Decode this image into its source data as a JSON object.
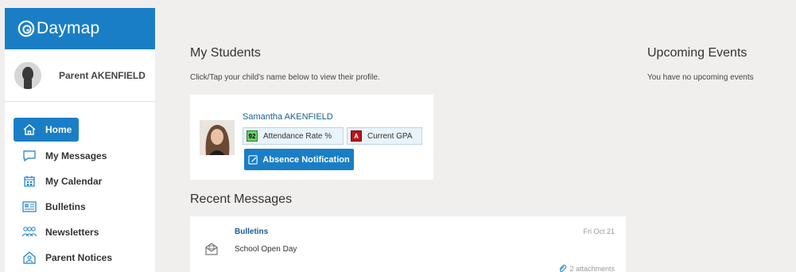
{
  "brand": {
    "name": "Daymap"
  },
  "profile": {
    "name": "Parent AKENFIELD"
  },
  "nav": {
    "items": [
      {
        "label": "Home",
        "icon": "home-icon"
      },
      {
        "label": "My Messages",
        "icon": "chat-icon"
      },
      {
        "label": "My Calendar",
        "icon": "calendar-icon"
      },
      {
        "label": "Bulletins",
        "icon": "bulletin-icon"
      },
      {
        "label": "Newsletters",
        "icon": "people-icon"
      },
      {
        "label": "Parent Notices",
        "icon": "notice-icon"
      }
    ]
  },
  "students": {
    "title": "My Students",
    "subtitle": "Click/Tap your child's name below to view their profile.",
    "student": {
      "name": "Samantha AKENFIELD",
      "attendance_value": "92",
      "attendance_label": "Attendance Rate %",
      "gpa_badge": "A",
      "gpa_label": "Current GPA",
      "absence_button": "Absence Notification"
    }
  },
  "messages": {
    "title": "Recent Messages",
    "items": [
      {
        "title": "Bulletins",
        "subject": "School Open Day",
        "date": "Fri Oct 21",
        "attachments": "2 attachments"
      }
    ]
  },
  "events": {
    "title": "Upcoming Events",
    "empty": "You have no upcoming events"
  },
  "colors": {
    "brand": "#1a7ec6",
    "background": "#f1efee",
    "link": "#1a5d8f"
  }
}
